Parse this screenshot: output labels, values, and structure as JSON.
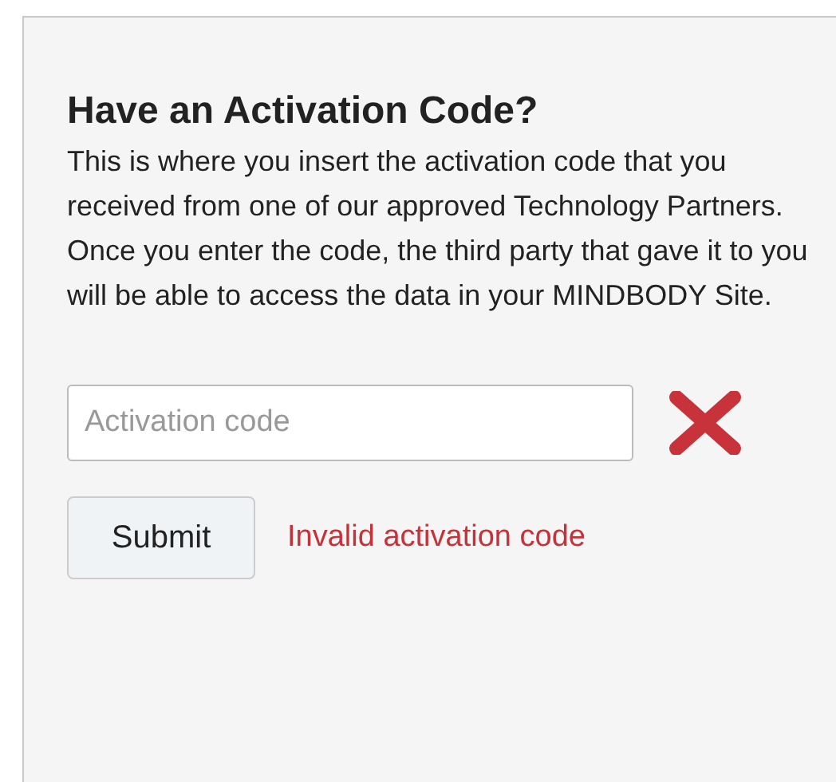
{
  "panel": {
    "title": "Have an Activation Code?",
    "description": "This is where you insert the activation code that you received from one of our approved Technology Partners. Once you enter the code, the third party that gave it to you will be able to access the data in your MINDBODY Site.",
    "field": {
      "placeholder": "Activation code",
      "invalid": true
    },
    "button": "Submit",
    "error": "Invalid activation code"
  }
}
